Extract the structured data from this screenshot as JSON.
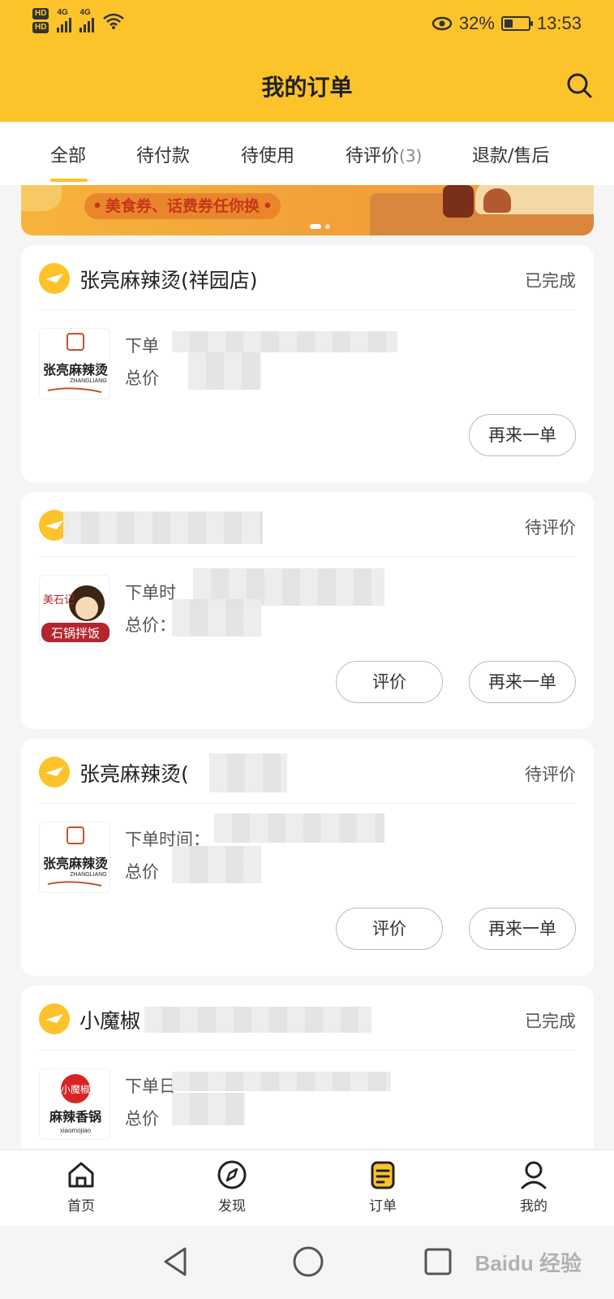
{
  "status_bar": {
    "hd1": "HD",
    "hd2": "HD",
    "net1": "4G",
    "net2": "4G",
    "battery_text": "32%",
    "battery_level": 0.32,
    "time": "13:53"
  },
  "header": {
    "title": "我的订单"
  },
  "tabs": [
    {
      "label": "全部",
      "active": true
    },
    {
      "label": "待付款"
    },
    {
      "label": "待使用"
    },
    {
      "label": "待评价",
      "count": "(3)"
    },
    {
      "label": "退款/售后"
    }
  ],
  "banner": {
    "text": "美食券、话费券任你换"
  },
  "orders": [
    {
      "shop": "张亮麻辣烫(祥园店)",
      "status": "已完成",
      "time_label": "下单",
      "price_label": "总价",
      "buttons": [
        "再来一单"
      ]
    },
    {
      "shop": "",
      "status": "待评价",
      "time_label": "下单时",
      "price_label": "总价：",
      "buttons": [
        "评价",
        "再来一单"
      ]
    },
    {
      "shop": "张亮麻辣烫(",
      "status": "待评价",
      "time_label": "下单时间：",
      "price_label": "总价",
      "buttons": [
        "评价",
        "再来一单"
      ]
    },
    {
      "shop": "小魔椒",
      "status": "已完成",
      "time_label": "下单日",
      "price_label": "总价"
    }
  ],
  "logos": {
    "zhangliang_main": "张亮麻辣烫",
    "zhangliang_en": "ZHANGLIANG",
    "meishiji_top": "美石记",
    "meishiji_bottom": "石锅拌饭",
    "xiaomojiao_top": "小魔椒",
    "xiaomojiao_main": "麻辣香锅",
    "xiaomojiao_en": "xiaomojiao"
  },
  "bottom_nav": [
    {
      "label": "首页",
      "icon": "home-icon"
    },
    {
      "label": "发现",
      "icon": "compass-icon"
    },
    {
      "label": "订单",
      "icon": "order-icon",
      "active": true
    },
    {
      "label": "我的",
      "icon": "profile-icon"
    }
  ],
  "watermark": "Baidu 经验",
  "colors": {
    "brand_yellow": "#fdc32a",
    "text_primary": "#222222",
    "text_secondary": "#555555"
  }
}
